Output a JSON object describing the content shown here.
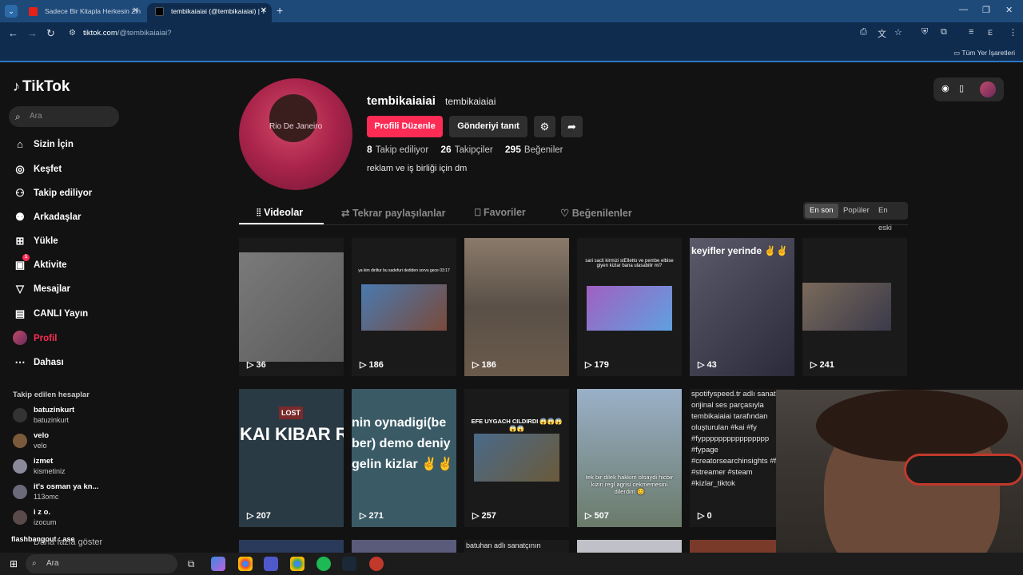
{
  "browser": {
    "tabs": [
      {
        "title": "Sadece Bir Kitapla Herkesin Zih",
        "active": false
      },
      {
        "title": "tembikaiaiai (@tembikaiaiai) | T",
        "active": true
      }
    ],
    "url_host": "tiktok.com",
    "url_path": "/@tembikaiaiai?",
    "bookmarks_label": "Tüm Yer İşaretleri",
    "profile_letter": "E"
  },
  "sidebar": {
    "logo": "TikTok",
    "search_placeholder": "Ara",
    "items": [
      {
        "label": "Sizin İçin",
        "icon": "home-icon"
      },
      {
        "label": "Keşfet",
        "icon": "compass-icon"
      },
      {
        "label": "Takip ediliyor",
        "icon": "user-follow-icon"
      },
      {
        "label": "Arkadaşlar",
        "icon": "friends-icon"
      },
      {
        "label": "Yükle",
        "icon": "upload-icon"
      },
      {
        "label": "Aktivite",
        "icon": "activity-icon",
        "badge": "1"
      },
      {
        "label": "Mesajlar",
        "icon": "messages-icon"
      },
      {
        "label": "CANLI Yayın",
        "icon": "live-icon"
      },
      {
        "label": "Profil",
        "icon": "profile-icon"
      },
      {
        "label": "Dahası",
        "icon": "more-icon"
      }
    ],
    "following_header": "Takip edilen hesaplar",
    "following": [
      {
        "name": "batuzinkurt",
        "handle": "batuzinkurt"
      },
      {
        "name": "velo",
        "handle": "velo"
      },
      {
        "name": "izmet",
        "handle": "kismetiniz"
      },
      {
        "name": "it's osman ya kn...",
        "handle": "113omc"
      },
      {
        "name": "i z o.",
        "handle": "izocum"
      }
    ],
    "show_more": "Daha fazla göster",
    "overlay_text": "flashbangout : ase"
  },
  "profile": {
    "username": "tembikaiaiai",
    "display_name": "tembikaiaiai",
    "avatar_caption": "Rio De Janeiro",
    "edit_button": "Profili Düzenle",
    "promote_button": "Gönderiyi tanıt",
    "stats": [
      {
        "value": "8",
        "label": "Takip ediliyor"
      },
      {
        "value": "26",
        "label": "Takipçiler"
      },
      {
        "value": "295",
        "label": "Beğeniler"
      }
    ],
    "bio": "reklam ve iş birliği için dm"
  },
  "tabs": [
    {
      "label": "Videolar",
      "icon": "grid-icon"
    },
    {
      "label": "Tekrar paylaşılanlar",
      "icon": "repost-icon"
    },
    {
      "label": "Favoriler",
      "icon": "bookmark-icon"
    },
    {
      "label": "Beğenilenler",
      "icon": "heart-icon"
    }
  ],
  "sort": [
    "En son",
    "Popüler",
    "En eski"
  ],
  "videos": [
    {
      "count": "36",
      "caption": ""
    },
    {
      "count": "186",
      "caption": "ya kim diriltur bu sadefuri dediden sorvu gece 03:17"
    },
    {
      "count": "186",
      "caption": ""
    },
    {
      "count": "179",
      "caption": "sari sacli kirmizi stElletto ve pembe elbise giyen kizlar bana ulasabilir mi?"
    },
    {
      "count": "43",
      "caption": "keyifler yerinde ✌️✌️"
    },
    {
      "count": "241",
      "caption": ""
    },
    {
      "count": "207",
      "caption": "KAI KIBAR R",
      "label": "LOST"
    },
    {
      "count": "271",
      "caption": "nin oynadigi(be ber) demo deniy gelin kizlar ✌️✌️"
    },
    {
      "count": "257",
      "caption": "EFE UYGACH CILDIRDI 😱😱😱😱😱"
    },
    {
      "count": "507",
      "caption": "tek bir dilek hakkim olsaydi hicbir kizin regl agrisi cekmemesini dilerdim 😊"
    },
    {
      "count": "0",
      "caption": "spotifyspeed.tr adlı sanatçının orijinal ses parçasıyla tembikaiaiai tarafından oluşturulan #kai #fy #fypppppppppppppppp #fypage #creatorsearchinsights #fyp #streamer #steam #kizlar_tiktok"
    }
  ],
  "bottom_row_caption": "batuhan adlı sanatçının",
  "taskbar": {
    "search_placeholder": "Ara"
  }
}
